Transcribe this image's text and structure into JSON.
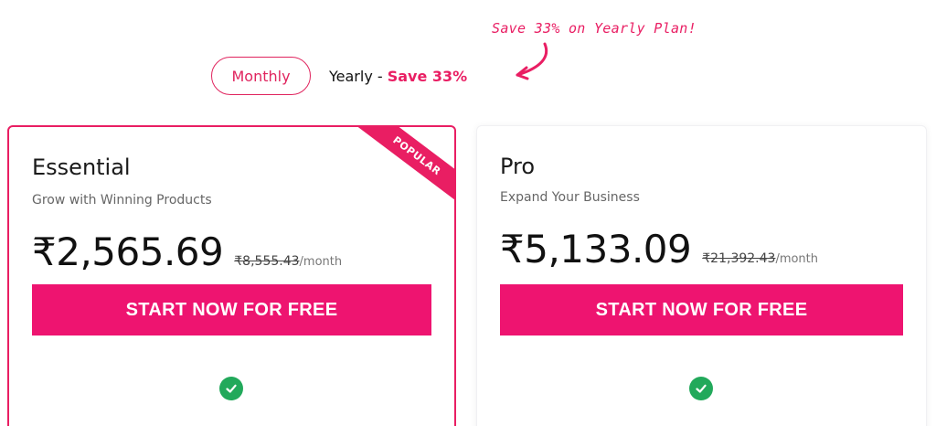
{
  "promo": {
    "note": "Save 33% on Yearly Plan!"
  },
  "billing_toggle": {
    "monthly_label": "Monthly",
    "yearly_label": "Yearly - ",
    "yearly_save": "Save 33%"
  },
  "plans": [
    {
      "name": "Essential",
      "subtitle": "Grow with Winning Products",
      "price": "₹2,565.69",
      "old_price": "₹8,555.43",
      "period": "/month",
      "cta": "START NOW FOR FREE",
      "badge": "POPULAR"
    },
    {
      "name": "Pro",
      "subtitle": "Expand Your Business",
      "price": "₹5,133.09",
      "old_price": "₹21,392.43",
      "period": "/month",
      "cta": "START NOW FOR FREE"
    }
  ],
  "colors": {
    "accent": "#e91e63",
    "cta": "#ee1470",
    "check": "#22a95b"
  }
}
